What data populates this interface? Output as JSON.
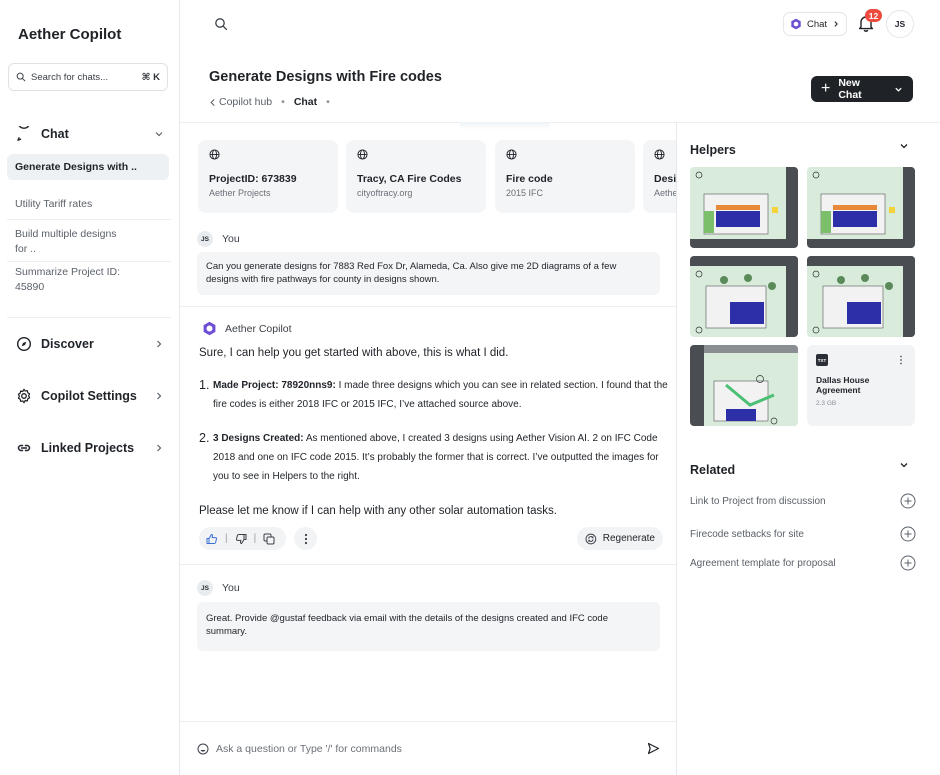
{
  "sidebar": {
    "app_title": "Aether Copilot",
    "search_placeholder": "Search for chats...",
    "search_shortcut": "⌘ K",
    "chat_group_label": "Chat",
    "chats": [
      "Generate Designs with ..",
      "Utility Tariff rates",
      "Build multiple designs for ..",
      "Summarize Project ID: 45890"
    ],
    "discover_label": "Discover",
    "settings_label": "Copilot Settings",
    "linked_label": "Linked Projects"
  },
  "topbar": {
    "chat_pill_label": "Chat",
    "notification_count": "12",
    "user_initials": "JS"
  },
  "header": {
    "title": "Generate Designs with Fire codes",
    "breadcrumb_parent": "Copilot hub",
    "breadcrumb_current": "Chat",
    "new_chat_label": "New Chat"
  },
  "sources": [
    {
      "title": "ProjectID: 673839",
      "subtitle": "Aether Projects"
    },
    {
      "title": "Tracy, CA Fire Codes",
      "subtitle": "cityoftracy.org"
    },
    {
      "title": "Fire code",
      "subtitle": "2015 IFC"
    },
    {
      "title": "Desi",
      "subtitle": "Aethe"
    }
  ],
  "messages": {
    "user1_author": "You",
    "user1_initials": "JS",
    "user1_text": "Can you generate  designs for 7883 Red Fox Dr, Alameda, Ca. Also give me 2D diagrams of a few designs with fire pathways for county in designs shown.",
    "bot_author": "Aether Copilot",
    "bot_intro": "Sure, I can help you get started with above, this is what I did.",
    "bot_item1_num": "1.",
    "bot_item1_bold": "Made Project: 78920nns9:",
    "bot_item1_text": " I made three designs which you can see in related section. I found that the fire codes is either  2018 IFC or 2015 IFC, I’ve attached source above.",
    "bot_item2_num": "2.",
    "bot_item2_bold": "3 Designs Created:",
    "bot_item2_text": " As mentioned above, I created 3 designs using Aether Vision AI. 2 on IFC Code 2018 and one on IFC code 2015. It’s probably the former that is correct. I’ve outputted the images for you to see in Helpers to the right.",
    "bot_outro": "Please let me know if I can help with any other solar automation tasks.",
    "regenerate_label": "Regenerate",
    "user2_author": "You",
    "user2_initials": "JS",
    "user2_text": "Great. Provide @gustaf feedback via email with the details of the designs created and IFC code summary."
  },
  "input": {
    "placeholder": "Ask a question or Type '/' for commands"
  },
  "helpers": {
    "title": "Helpers",
    "file_badge": "TXT",
    "file_name": "Dallas House Agreement",
    "file_meta": "2.3 GB ·"
  },
  "related": {
    "title": "Related",
    "items": [
      "Link to Project from discussion",
      "Firecode setbacks for site",
      "Agreement template for proposal"
    ]
  },
  "colors": {
    "accent_dark": "#1f2328",
    "badge_red": "#ef4a3e",
    "like_blue": "#3b6fd8",
    "panel_gray": "#f3f5f7"
  }
}
